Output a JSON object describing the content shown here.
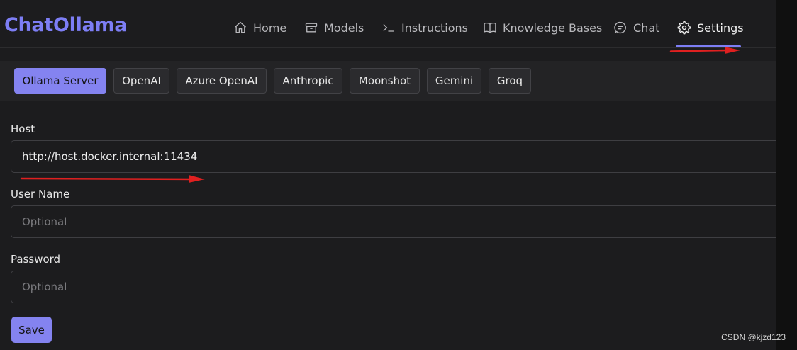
{
  "brand": {
    "name": "ChatOllama",
    "color": "#7d7ef5"
  },
  "nav": [
    {
      "label": "Home",
      "icon": "home-icon"
    },
    {
      "label": "Models",
      "icon": "box-icon"
    },
    {
      "label": "Instructions",
      "icon": "terminal-icon"
    },
    {
      "label": "Knowledge Bases",
      "icon": "book-icon"
    },
    {
      "label": "Chat",
      "icon": "chat-icon"
    },
    {
      "label": "Settings",
      "icon": "gear-icon",
      "active": true
    }
  ],
  "provider_tabs": [
    {
      "label": "Ollama Server",
      "active": true
    },
    {
      "label": "OpenAI"
    },
    {
      "label": "Azure OpenAI"
    },
    {
      "label": "Anthropic"
    },
    {
      "label": "Moonshot"
    },
    {
      "label": "Gemini"
    },
    {
      "label": "Groq"
    }
  ],
  "form": {
    "host": {
      "label": "Host",
      "value": "http://host.docker.internal:11434"
    },
    "username": {
      "label": "User Name",
      "placeholder": "Optional"
    },
    "password": {
      "label": "Password",
      "placeholder": "Optional"
    },
    "save_label": "Save"
  },
  "annotations": {
    "arrow_color": "#e02020"
  },
  "watermark": "CSDN @kjzd123"
}
